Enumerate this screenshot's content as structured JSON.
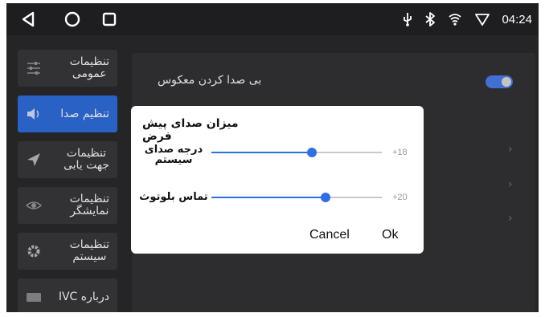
{
  "status_bar": {
    "time": "04:24",
    "icons": [
      "usb-icon",
      "bluetooth-icon",
      "wifi-calling-icon",
      "signal-icon"
    ]
  },
  "nav": {
    "icons": [
      "back-icon",
      "home-icon",
      "recents-icon"
    ]
  },
  "sidebar": {
    "items": [
      {
        "label": "تنظیمات\nعمومی",
        "icon": "sliders-icon",
        "active": false
      },
      {
        "label": "تنظیم صدا",
        "icon": "speaker-icon",
        "active": true
      },
      {
        "label": "تنظیمات\nجهت یابی",
        "icon": "navigation-arrow-icon",
        "active": false
      },
      {
        "label": "تنظیمات\nنمایشگر",
        "icon": "eye-icon",
        "active": false
      },
      {
        "label": "تنظیمات\nسیستم",
        "icon": "gear-icon",
        "active": false
      },
      {
        "label": "درباره IVC",
        "icon": "card-icon",
        "active": false
      }
    ]
  },
  "content": {
    "mute_reverse_label": "بی صدا کردن معکوس",
    "mute_reverse_on": true
  },
  "dialog": {
    "title": "میزان صدای پیش فرض",
    "sliders": [
      {
        "label": "درجه صدای\nسیستم",
        "value": "+18",
        "level": 0.59
      },
      {
        "label": "تماس بلوتوث",
        "value": "+20",
        "level": 0.67
      }
    ],
    "cancel_label": "Cancel",
    "ok_label": "Ok"
  },
  "colors": {
    "accent": "#2f6fe0",
    "background": "#2b2b2d",
    "panel": "#343436",
    "sidebar_item": "#3a3a3c"
  }
}
